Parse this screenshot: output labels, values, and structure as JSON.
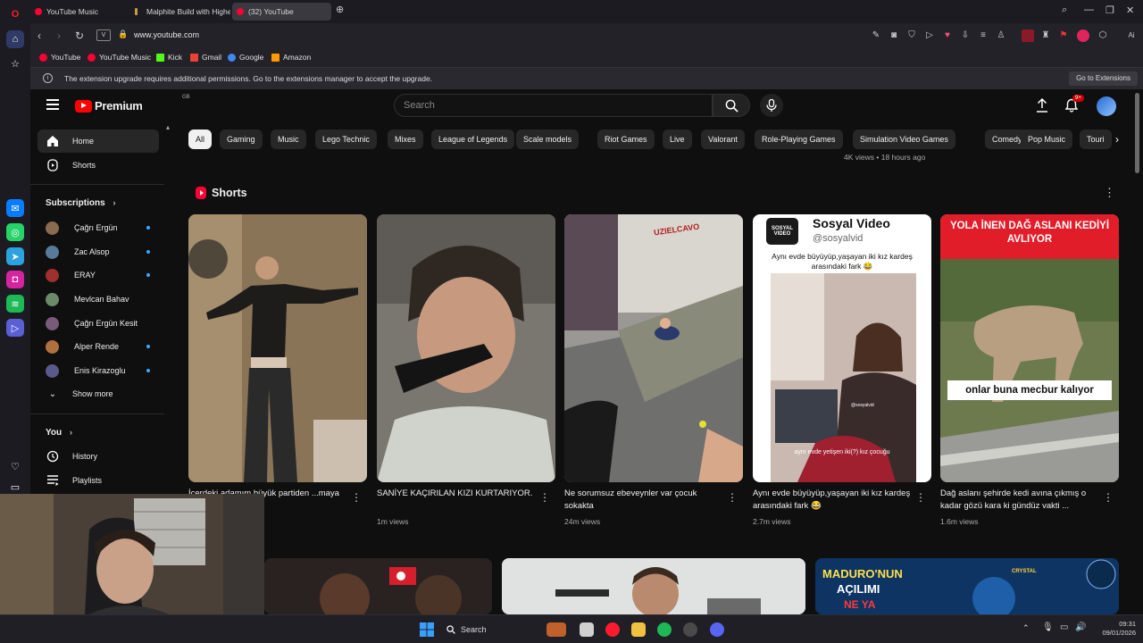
{
  "browser": {
    "tabs": [
      {
        "label": "YouTube Music",
        "color": "#ff0033"
      },
      {
        "label": "Malphite Build with Highe",
        "color": "#c89b3c"
      },
      {
        "label": "(32) YouTube",
        "color": "#ff0033"
      }
    ],
    "url": "www.youtube.com",
    "bookmarks": [
      {
        "label": "YouTube",
        "color": "#ff0033"
      },
      {
        "label": "YouTube Music",
        "color": "#ff0033"
      },
      {
        "label": "Kick",
        "color": "#53fc18"
      },
      {
        "label": "Gmail",
        "color": "#ea4335"
      },
      {
        "label": "Google",
        "color": "#4285f4"
      },
      {
        "label": "Amazon",
        "color": "#ff9900"
      }
    ],
    "infobar": {
      "message": "The extension upgrade requires additional permissions. Go to the extensions manager to accept the upgrade.",
      "button": "Go to Extensions"
    }
  },
  "header": {
    "logo_text": "Premium",
    "region": "GB",
    "search_placeholder": "Search",
    "notification_count": "9+"
  },
  "sidebar": {
    "main": [
      {
        "label": "Home",
        "icon": "home-icon"
      },
      {
        "label": "Shorts",
        "icon": "shorts-icon"
      }
    ],
    "subscriptions_title": "Subscriptions",
    "subscriptions": [
      {
        "label": "Çağrı Ergün",
        "color": "#8a6a50"
      },
      {
        "label": "Zac Alsop",
        "color": "#5a7a9a"
      },
      {
        "label": "ERAY",
        "color": "#a03030"
      },
      {
        "label": "Mevlcan Bahav",
        "color": "#6a8a6a"
      },
      {
        "label": "Çağrı Ergün Kesit",
        "color": "#7a5a7a"
      },
      {
        "label": "Alper Rende",
        "color": "#b07040"
      },
      {
        "label": "Enis Kirazoglu",
        "color": "#5a5a8a"
      }
    ],
    "show_more": "Show more",
    "you_title": "You",
    "you_items": [
      {
        "label": "History",
        "icon": "history-icon"
      },
      {
        "label": "Playlists",
        "icon": "playlists-icon"
      }
    ]
  },
  "chips": [
    "All",
    "Gaming",
    "Music",
    "Lego Technic",
    "Mixes",
    "League of Legends",
    "Scale models",
    "Riot Games",
    "Live",
    "Valorant",
    "Role-Playing Games",
    "Simulation Video Games",
    "Comedy",
    "Pop Music",
    "Touri"
  ],
  "previous_meta": "4K views • 18 hours ago",
  "shorts_section": {
    "title": "Shorts",
    "items": [
      {
        "title": "İçerdeki adamım büyük partiden ...maya başladı ...",
        "views": ""
      },
      {
        "title": "SANİYE KAÇIRILAN KIZI KURTARIYOR.",
        "views": "1m views"
      },
      {
        "title": "Ne sorumsuz ebeveynler var çocuk sokakta",
        "views": "24m views"
      },
      {
        "title": "Aynı evde büyüyüp,yaşayan iki kız kardeş arasındaki fark 😂",
        "views": "2.7m views"
      },
      {
        "title": "Dağ aslanı şehirde kedi avına çıkmış o kadar gözü kara ki gündüz vakti ...",
        "views": "1.6m views"
      }
    ],
    "overlays": {
      "short3_graffiti": "UZIELCAVO",
      "short4_channel": "Sosyal Video",
      "short4_handle": "@sosyalvid",
      "short4_caption": "Aynı evde büyüyüp,yaşayan iki kız kardeş arasındaki fark 😂",
      "short4_sub": "aynı evde yetişen iki(?) kız çocuğu",
      "short4_logo": "SOSYAL VIDEO",
      "short4_watermark": "@sosyalvid",
      "short5_top": "YOLA İNEN DAĞ ASLANI KEDİYİ AVLIYOR",
      "short5_bottom": "onlar buna mecbur kalıyor"
    }
  },
  "videos_row": {
    "thumb3_text_1": "MADURO'NUN",
    "thumb3_text_2": "AÇILIMI",
    "thumb3_text_3": "NE YA",
    "thumb3_badge": "CRYSTAL"
  },
  "taskbar": {
    "search": "Search",
    "time": "09:31",
    "date": "09/01/2026"
  }
}
